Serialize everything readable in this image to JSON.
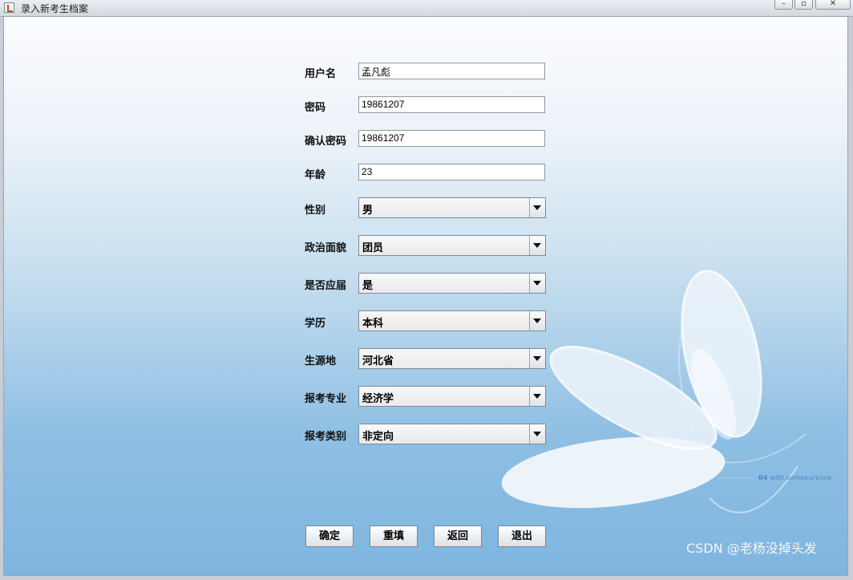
{
  "window": {
    "title": "录入新考生档案"
  },
  "form": {
    "username_label": "用户名",
    "username_value": "孟凡彪",
    "password_label": "密码",
    "password_value": "19861207",
    "confirm_label": "确认密码",
    "confirm_value": "19861207",
    "age_label": "年龄",
    "age_value": "23",
    "gender_label": "性别",
    "gender_value": "男",
    "political_label": "政治面貌",
    "political_value": "团员",
    "fresh_label": "是否应届",
    "fresh_value": "是",
    "education_label": "学历",
    "education_value": "本科",
    "origin_label": "生源地",
    "origin_value": "河北省",
    "major_label": "报考专业",
    "major_value": "经济学",
    "category_label": "报考类别",
    "category_value": "非定向"
  },
  "buttons": {
    "confirm": "确定",
    "reset": "重填",
    "back": "返回",
    "exit": "退出"
  },
  "decoration": {
    "slogan_prefix": "04",
    "slogan_text": "with,somepurpose"
  },
  "watermark": "CSDN @老杨没掉头发"
}
